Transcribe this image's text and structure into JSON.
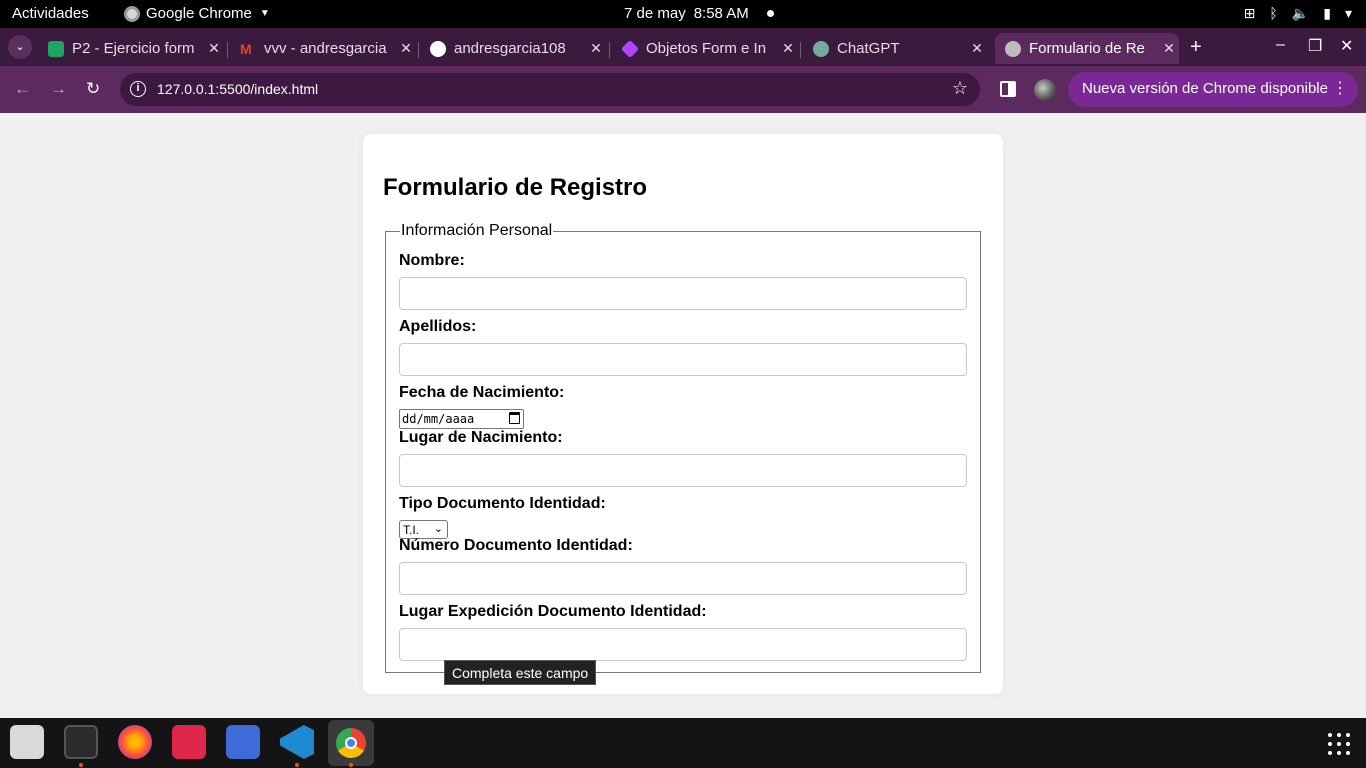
{
  "system_bar": {
    "activities": "Actividades",
    "app_name": "Google Chrome",
    "date": "7 de may",
    "time": "8:58 AM"
  },
  "tabs": [
    {
      "title": "P2 - Ejercicio form",
      "favicon_color": "#1ea362"
    },
    {
      "title": "vvv - andresgarcia",
      "favicon_color": "#ea4335"
    },
    {
      "title": "andresgarcia108",
      "favicon_color": "#ffffff"
    },
    {
      "title": "Objetos Form e In",
      "favicon_color": "#b044ff"
    },
    {
      "title": "ChatGPT",
      "favicon_color": "#74aa9c"
    },
    {
      "title": "Formulario de Re",
      "favicon_color": "#bdbdbd"
    }
  ],
  "toolbar": {
    "url": "127.0.0.1:5500/index.html",
    "update_label": "Nueva versión de Chrome disponible"
  },
  "form": {
    "title": "Formulario de Registro",
    "legend": "Información Personal",
    "labels": {
      "nombre": "Nombre:",
      "apellidos": "Apellidos:",
      "fecha": "Fecha de Nacimiento:",
      "lugar": "Lugar de Nacimiento:",
      "tipo_doc": "Tipo Documento Identidad:",
      "num_doc": "Número Documento Identidad:",
      "lugar_exp": "Lugar Expedición Documento Identidad:"
    },
    "date_placeholder": "dd/mm/aaaa",
    "tipo_doc_selected": "T.I.",
    "tooltip": "Completa este campo"
  },
  "colors": {
    "tabstrip": "#3a1a3d",
    "toolbar": "#5c2a5e",
    "update_pill": "#7a2896"
  }
}
